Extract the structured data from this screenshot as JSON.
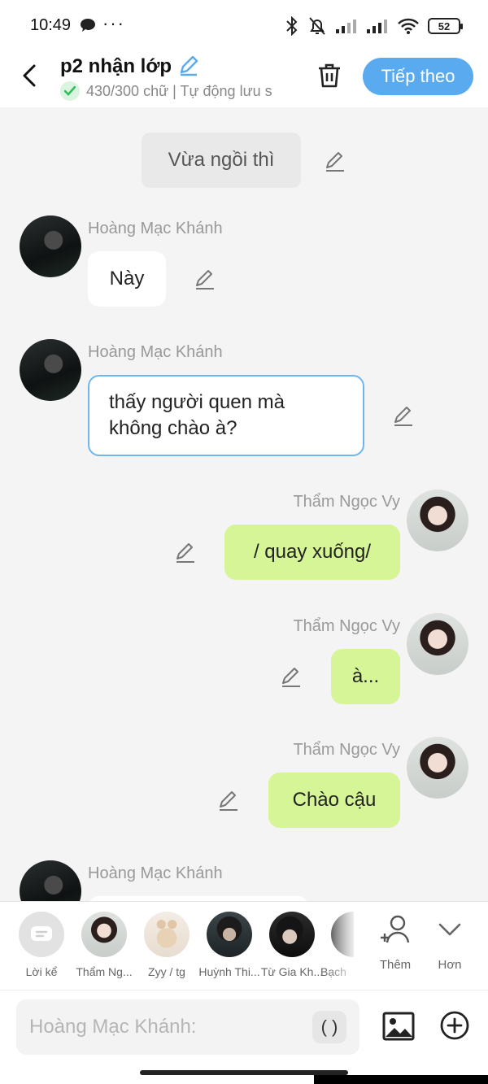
{
  "status_bar": {
    "time": "10:49",
    "dots": "···",
    "battery": "52",
    "icons": [
      "chat-bubble-icon",
      "bluetooth-icon",
      "silent-bell-icon",
      "signal-icon",
      "signal-icon",
      "wifi-icon",
      "battery-icon"
    ]
  },
  "header": {
    "title": "p2 nhận lớp",
    "subtitle": "430/300 chữ | Tự động lưu s",
    "next_label": "Tiếp theo",
    "colors": {
      "accent": "#5aaaf0"
    }
  },
  "chat": {
    "narration": "Vừa ngồi thì",
    "messages": [
      {
        "sender": "Hoàng Mạc Khánh",
        "text": "Này"
      },
      {
        "sender": "Hoàng Mạc Khánh",
        "line1": "thấy người quen mà",
        "line2": "không chào à?"
      },
      {
        "sender": "Thẩm Ngọc Vy",
        "text": "/ quay xuống/"
      },
      {
        "sender": "Thẩm Ngọc Vy",
        "text": "à..."
      },
      {
        "sender": "Thẩm Ngọc Vy",
        "text": "Chào cậu"
      },
      {
        "sender": "Hoàng Mạc Khánh"
      }
    ],
    "colors": {
      "my_bubble": "#d6f596",
      "other_bubble": "#ffffff",
      "selected_border": "#6fb6ee"
    }
  },
  "characters": [
    {
      "name": "Lời kể"
    },
    {
      "name": "Thẩm Ng..."
    },
    {
      "name": "Zyy / tg"
    },
    {
      "name": "Huỳnh Thi..."
    },
    {
      "name": "Từ Gia Kh..."
    },
    {
      "name": "Bạch"
    }
  ],
  "actions": {
    "add_label": "Thêm",
    "more_label": "Hơn"
  },
  "composer": {
    "placeholder": "Hoàng Mạc Khánh:",
    "paren_label": "( )"
  }
}
